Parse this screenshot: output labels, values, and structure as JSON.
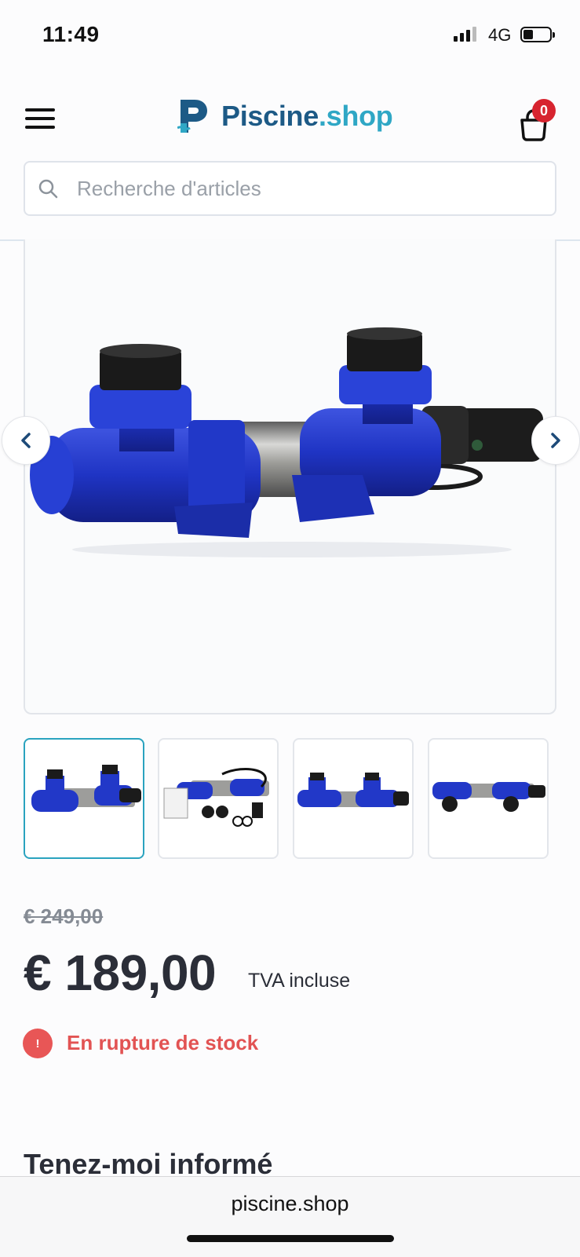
{
  "status_bar": {
    "time": "11:49",
    "network": "4G"
  },
  "header": {
    "brand_main": "Piscine",
    "brand_tld": ".shop",
    "cart_count": "0"
  },
  "search": {
    "placeholder": "Recherche d'articles"
  },
  "gallery": {
    "thumbnails": [
      "view-front",
      "view-kit-contents",
      "view-side",
      "view-top"
    ]
  },
  "product": {
    "old_price": "€ 249,00",
    "price": "€ 189,00",
    "vat_note": "TVA incluse",
    "stock_icon": "!",
    "stock_status": "En rupture de stock",
    "notify_heading": "Tenez-moi informé"
  },
  "browser": {
    "url": "piscine.shop"
  },
  "colors": {
    "brand_dark": "#1d5a86",
    "brand_light": "#2fa7c5",
    "badge": "#d7242f",
    "out_of_stock": "#e25353",
    "thumb_active": "#2aa3bf"
  }
}
